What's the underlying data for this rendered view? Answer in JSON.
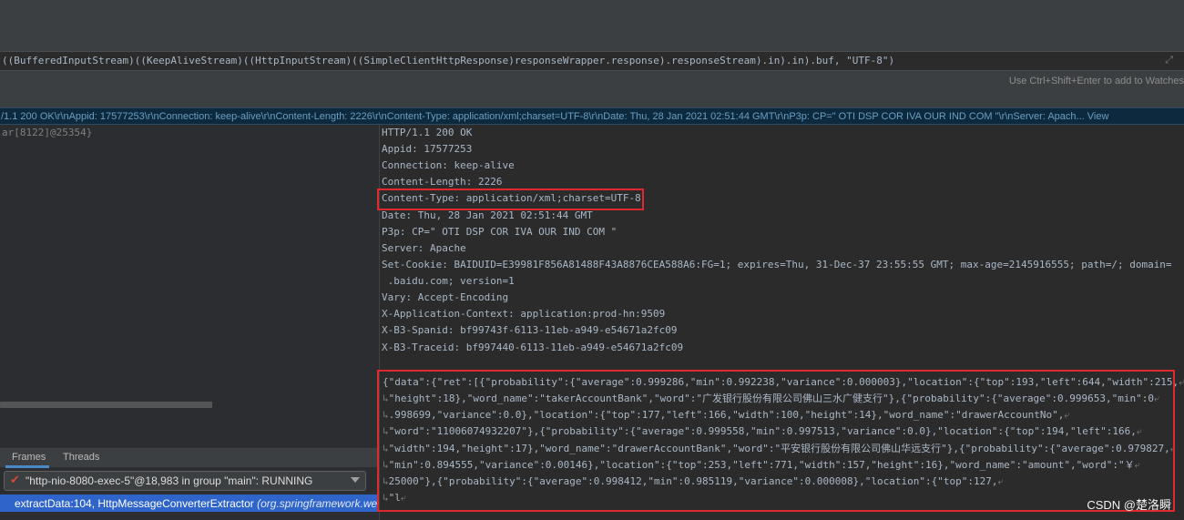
{
  "evaluate": {
    "expression": "((BufferedInputStream)((KeepAliveStream)((HttpInputStream)((SimpleClientHttpResponse)responseWrapper.response).responseStream).in).in).buf, \"UTF-8\")",
    "hint": "Use Ctrl+Shift+Enter to add to Watches"
  },
  "result_bar": "/1.1 200 OK\\r\\nAppid: 17577253\\r\\nConnection: keep-alive\\r\\nContent-Length: 2226\\r\\nContent-Type: application/xml;charset=UTF-8\\r\\nDate: Thu, 28 Jan 2021 02:51:44 GMT\\r\\nP3p: CP=\" OTI DSP COR IVA OUR IND COM \"\\r\\nServer: Apach... View",
  "debugger": {
    "thread_id": "ar[8122]@25354}",
    "tabs": {
      "frames": "Frames",
      "threads": "Threads"
    },
    "thread_select": "\"http-nio-8080-exec-5\"@18,983 in group \"main\": RUNNING",
    "selected_frame": {
      "method": "extractData:104, HttpMessageConverterExtractor ",
      "package": "(org.springframework.web"
    }
  },
  "response": {
    "headers": [
      "HTTP/1.1 200 OK",
      "Appid: 17577253",
      "Connection: keep-alive",
      "Content-Length: 2226",
      "Content-Type: application/xml;charset=UTF-8",
      "Date: Thu, 28 Jan 2021 02:51:44 GMT",
      "P3p: CP=\" OTI DSP COR IVA OUR IND COM \"",
      "Server: Apache",
      "Set-Cookie: BAIDUID=E39981F856A81488F43A8876CEA588A6:FG=1; expires=Thu, 31-Dec-37 23:55:55 GMT; max-age=2145916555; path=/; domain=",
      " .baidu.com; version=1",
      "Vary: Accept-Encoding",
      "X-Application-Context: application:prod-hn:9509",
      "X-B3-Spanid: bf99743f-6113-11eb-a949-e54671a2fc09",
      "X-B3-Traceid: bf997440-6113-11eb-a949-e54671a2fc09"
    ],
    "body": [
      "{\"data\":{\"ret\":[{\"probability\":{\"average\":0.999286,\"min\":0.992238,\"variance\":0.000003},\"location\":{\"top\":193,\"left\":644,\"width\":215,",
      "\"height\":18},\"word_name\":\"takerAccountBank\",\"word\":\"广发银行股份有限公司佛山三水广健支行\"},{\"probability\":{\"average\":0.999653,\"min\":0",
      ".998699,\"variance\":0.0},\"location\":{\"top\":177,\"left\":166,\"width\":100,\"height\":14},\"word_name\":\"drawerAccountNo\",",
      "\"word\":\"11006074932207\"},{\"probability\":{\"average\":0.999558,\"min\":0.997513,\"variance\":0.0},\"location\":{\"top\":194,\"left\":166,",
      "\"width\":194,\"height\":17},\"word_name\":\"drawerAccountBank\",\"word\":\"平安银行股份有限公司佛山华远支行\"},{\"probability\":{\"average\":0.979827,",
      "\"min\":0.894555,\"variance\":0.00146},\"location\":{\"top\":253,\"left\":771,\"width\":157,\"height\":16},\"word_name\":\"amount\",\"word\":\"￥",
      "25000\"},{\"probability\":{\"average\":0.998412,\"min\":0.985119,\"variance\":0.000008},\"location\":{\"top\":127,",
      "\"l"
    ]
  },
  "watermark": "CSDN @楚洛瞬",
  "colors": {
    "highlight": "#e0292d",
    "selection": "#2f65ca",
    "code_text": "#a9b7c6"
  }
}
